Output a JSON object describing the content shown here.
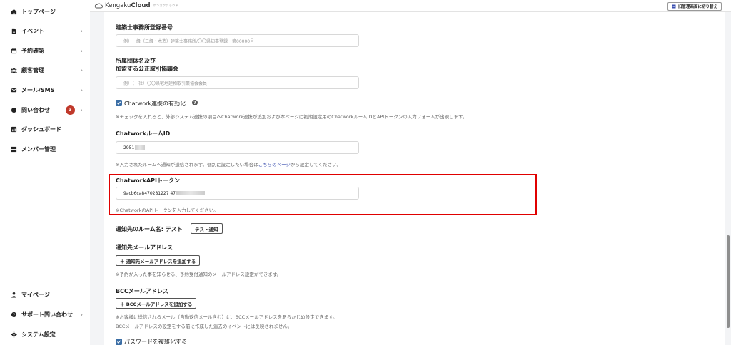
{
  "sidebar": {
    "top_items": [
      {
        "label": "トップページ",
        "icon": "home-icon",
        "arrow": false
      },
      {
        "label": "イベント",
        "icon": "document-icon",
        "arrow": true
      },
      {
        "label": "予約確認",
        "icon": "calendar-icon",
        "arrow": true
      },
      {
        "label": "顧客管理",
        "icon": "users-icon",
        "arrow": true
      },
      {
        "label": "メール/SMS",
        "icon": "mail-icon",
        "arrow": true
      },
      {
        "label": "問い合わせ",
        "icon": "chat-icon",
        "arrow": true,
        "badge": "3"
      },
      {
        "label": "ダッシュボード",
        "icon": "chart-icon",
        "arrow": false
      },
      {
        "label": "メンバー管理",
        "icon": "grid-icon",
        "arrow": false
      }
    ],
    "bottom_items": [
      {
        "label": "マイページ",
        "icon": "person-icon",
        "arrow": false
      },
      {
        "label": "サポート問い合わせ",
        "icon": "question-icon",
        "arrow": true
      },
      {
        "label": "システム設定",
        "icon": "gear-icon",
        "arrow": false
      }
    ]
  },
  "header": {
    "logo_brand_light": "Kengaku",
    "logo_brand_bold": "Cloud",
    "logo_sub": "ケンガククラウド",
    "switch_button": "旧管理画面に切り替え"
  },
  "form": {
    "registration": {
      "label": "建築士事務所登録番号",
      "placeholder": "例）一級（二級・木造）建築士事務所/〇〇県知事登録　第00000号"
    },
    "association": {
      "label_line1": "所属団体名及び",
      "label_line2": "加盟する公正取引協議会",
      "placeholder": "例）（一社）〇〇県宅地建物取引業協会会員"
    },
    "chatwork_enable": {
      "label": "Chatwork連携の有効化",
      "help": "?",
      "note": "※チェックを入れると、外部システム連携の項目へChatwork連携が追加および本ページに初期設定用のChatworkルームIDとAPIトークンの入力フォームが出現します。"
    },
    "room_id": {
      "label": "ChatworkルームID",
      "value": "2951",
      "note_before": "※入力されたルームへ通知が送信されます。個別に設定したい場合は",
      "note_link": "こちらのページ",
      "note_after": "から設定してください。"
    },
    "api_token": {
      "label": "ChatworkAPIトークン",
      "value": "9acb6ca8470281227 47",
      "note": "※ChatworkのAPIトークンを入力してください。"
    },
    "notify_room": {
      "label": "通知先のルーム名: テスト",
      "button": "テスト通知"
    },
    "notify_email": {
      "label": "通知先メールアドレス",
      "button": "＋ 通知先メールアドレスを追加する",
      "note": "※予約が入った事を知らせる、予約受付通知のメールアドレス設定ができます。"
    },
    "bcc_email": {
      "label": "BCCメールアドレス",
      "button": "＋ BCCメールアドレスを追加する",
      "note_line1": "※お客様に送信されるメール（自動返信メール含む）に、BCCメールアドレスをあらかじめ設定できます。",
      "note_line2": "BCCメールアドレスの設定をする前に作成した過去のイベントには反映されません。"
    },
    "password": {
      "label": "パスワードを複雑化する"
    }
  },
  "colors": {
    "accent": "#3b6ea5",
    "highlight": "#e00000",
    "badge": "#c0392b",
    "link": "#3b4fb0"
  }
}
